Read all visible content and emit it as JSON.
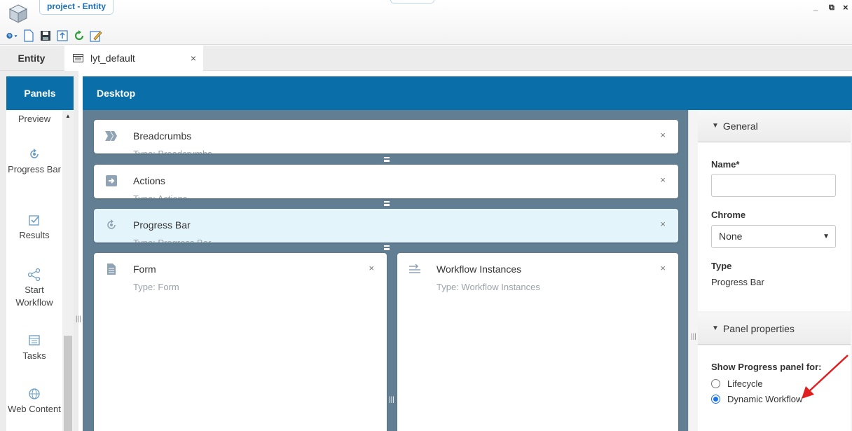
{
  "window": {
    "title": "project - Entity",
    "controls": {
      "minimize": "_",
      "restore": "⧉",
      "close": "×"
    },
    "logo_icon": "cube-logo-icon"
  },
  "toolbar": {
    "icons": [
      "globe-dropdown-icon",
      "new-document-icon",
      "save-icon",
      "export-icon",
      "refresh-icon",
      "edit-icon"
    ]
  },
  "tabs": {
    "entity_label": "Entity",
    "layout_label": "lyt_default",
    "close": "×"
  },
  "panels": {
    "header": "Panels",
    "items": [
      {
        "label": "Preview",
        "icon": "preview-icon"
      },
      {
        "label": "Progress Bar",
        "icon": "progress-cycle-icon"
      },
      {
        "label": "Results",
        "icon": "results-check-icon"
      },
      {
        "label": "Start Workflow",
        "icon": "workflow-icon"
      },
      {
        "label": "Tasks",
        "icon": "tasks-list-icon"
      },
      {
        "label": "Web Content",
        "icon": "globe-icon"
      }
    ]
  },
  "desktop": {
    "header": "Desktop",
    "cards": [
      {
        "title": "Breadcrumbs",
        "type": "Type: Breadcrumbs",
        "icon": "breadcrumbs-icon",
        "close": "×"
      },
      {
        "title": "Actions",
        "type": "Type: Actions",
        "icon": "actions-arrow-icon",
        "close": "×"
      },
      {
        "title": "Progress Bar",
        "type": "Type: Progress Bar",
        "icon": "progress-cycle-icon",
        "close": "×",
        "selected": true
      },
      {
        "title": "Form",
        "type": "Type: Form",
        "icon": "form-document-icon",
        "close": "×"
      },
      {
        "title": "Workflow Instances",
        "type": "Type: Workflow Instances",
        "icon": "workflow-instances-icon",
        "close": "×"
      }
    ]
  },
  "properties": {
    "general": {
      "header": "General",
      "name_label": "Name*",
      "name_value": "",
      "chrome_label": "Chrome",
      "chrome_value": "None",
      "type_label": "Type",
      "type_value": "Progress Bar"
    },
    "panel_properties": {
      "header": "Panel properties",
      "show_label": "Show Progress panel for:",
      "options": [
        {
          "label": "Lifecycle",
          "checked": false
        },
        {
          "label": "Dynamic Workflow",
          "checked": true
        }
      ]
    }
  },
  "colors": {
    "header_blue": "#0a6ea8",
    "canvas": "#627e93",
    "selected_card": "#e4f4fb",
    "annotation_arrow": "#e02020"
  }
}
